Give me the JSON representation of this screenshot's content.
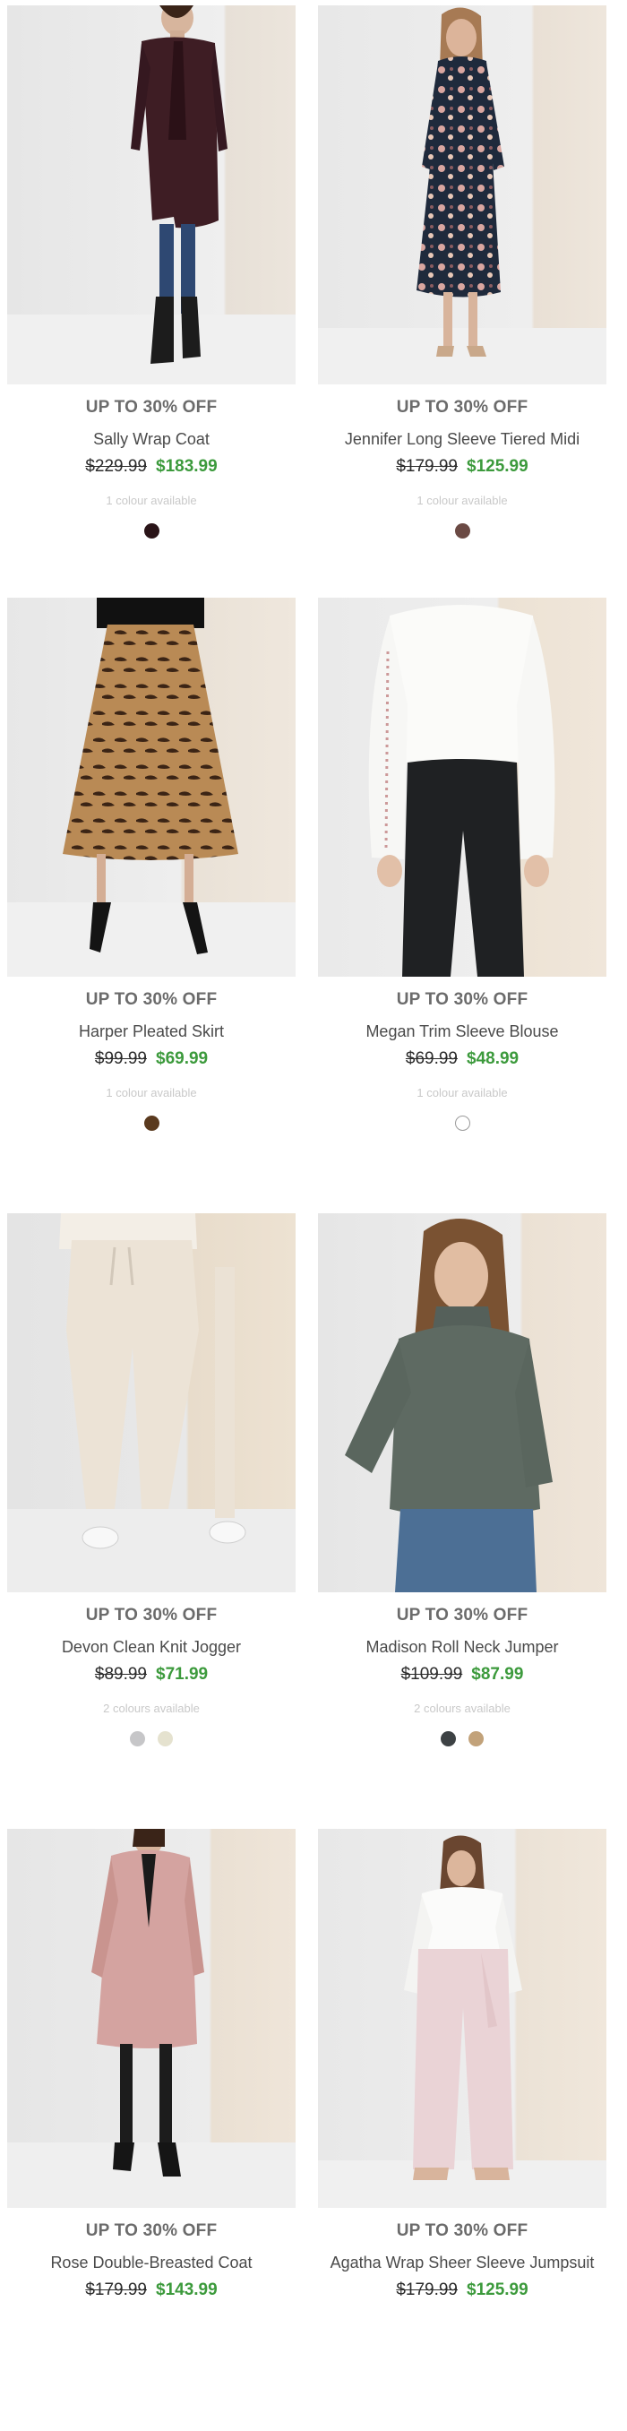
{
  "products": [
    {
      "promo": "UP TO 30% OFF",
      "name": "Sally Wrap Coat",
      "was_price": "$229.99",
      "now_price": "$183.99",
      "availability": "1 colour available",
      "swatches": [
        "#2a1418"
      ],
      "image": "woman-in-burgundy-wrap-coat"
    },
    {
      "promo": "UP TO 30% OFF",
      "name": "Jennifer Long Sleeve Tiered Midi",
      "was_price": "$179.99",
      "now_price": "$125.99",
      "availability": "1 colour available",
      "swatches": [
        "#6b4a44"
      ],
      "image": "woman-in-floral-midi-dress"
    },
    {
      "promo": "UP TO 30% OFF",
      "name": "Harper Pleated Skirt",
      "was_price": "$99.99",
      "now_price": "$69.99",
      "availability": "1 colour available",
      "swatches": [
        "#5a3a1e"
      ],
      "image": "tiger-print-pleated-skirt"
    },
    {
      "promo": "UP TO 30% OFF",
      "name": "Megan Trim Sleeve Blouse",
      "was_price": "$69.99",
      "now_price": "$48.99",
      "availability": "1 colour available",
      "swatches": [
        "#ffffff"
      ],
      "image": "white-blouse-black-pants"
    },
    {
      "promo": "UP TO 30% OFF",
      "name": "Devon Clean Knit Jogger",
      "was_price": "$89.99",
      "now_price": "$71.99",
      "availability": "2 colours available",
      "swatches": [
        "#c6c6c8",
        "#e5e2cf"
      ],
      "image": "cream-knit-joggers"
    },
    {
      "promo": "UP TO 30% OFF",
      "name": "Madison Roll Neck Jumper",
      "was_price": "$109.99",
      "now_price": "$87.99",
      "availability": "2 colours available",
      "swatches": [
        "#3d4244",
        "#c2a27a"
      ],
      "image": "woman-in-green-roll-neck-jumper"
    },
    {
      "promo": "UP TO 30% OFF",
      "name": "Rose Double-Breasted Coat",
      "was_price": "$179.99",
      "now_price": "$143.99",
      "availability": "",
      "swatches": [],
      "image": "woman-in-pink-coat"
    },
    {
      "promo": "UP TO 30% OFF",
      "name": "Agatha Wrap Sheer Sleeve Jumpsuit",
      "was_price": "$179.99",
      "now_price": "$125.99",
      "availability": "",
      "swatches": [],
      "image": "woman-in-wrap-jumpsuit"
    }
  ]
}
